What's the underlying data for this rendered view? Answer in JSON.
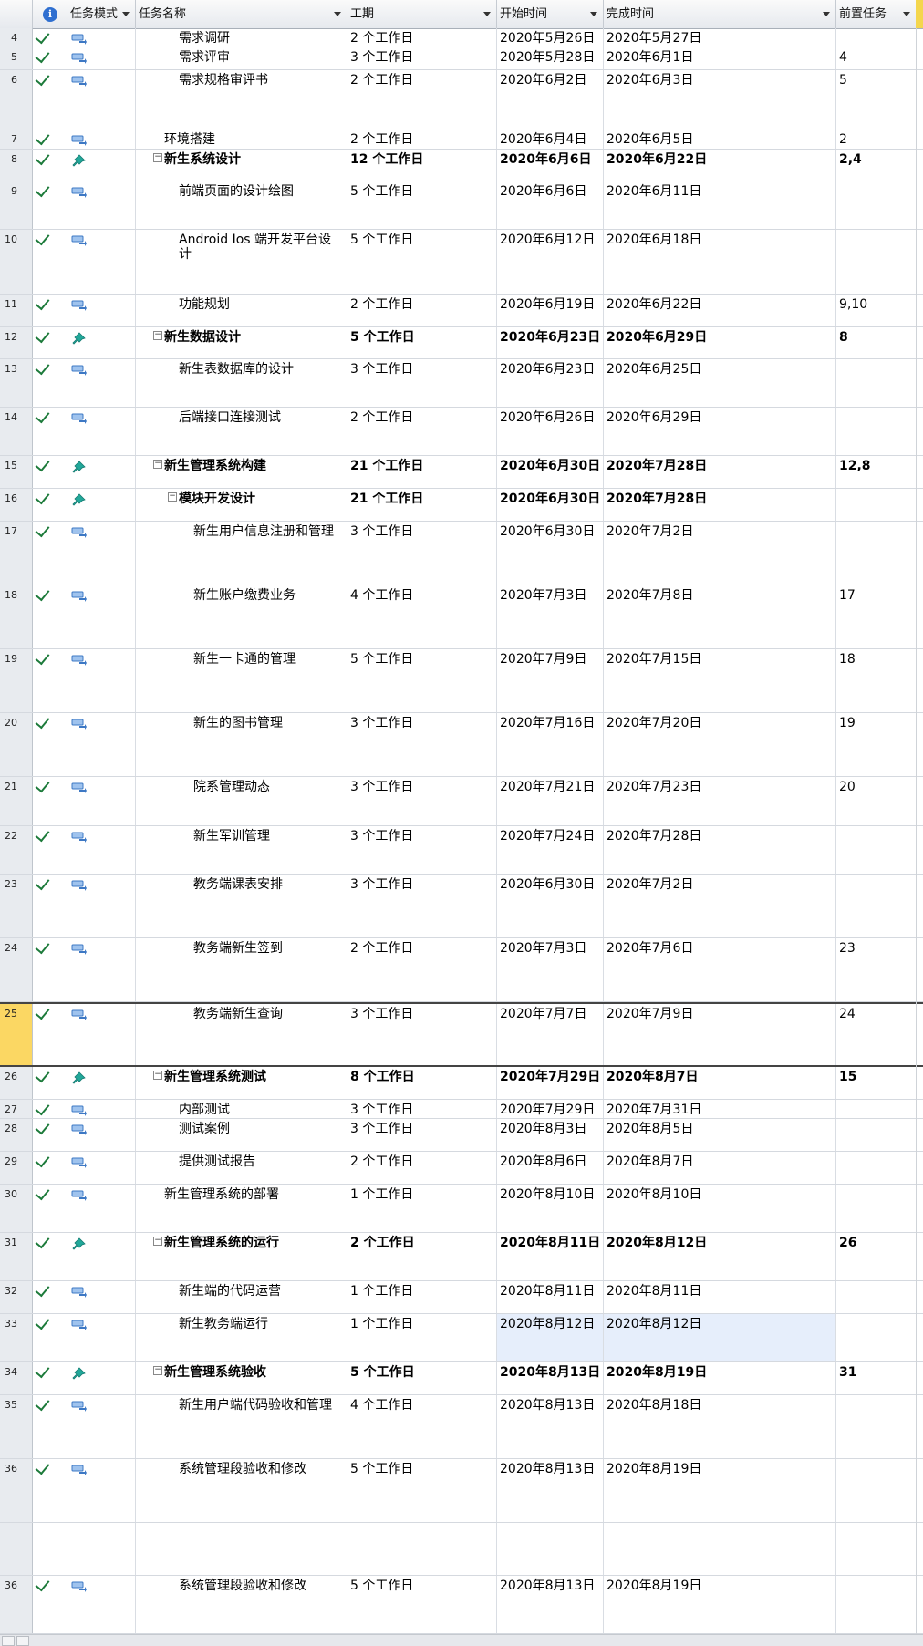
{
  "header": {
    "info_label": "i",
    "mode_label": "任务模式",
    "name_label": "任务名称",
    "duration_label": "工期",
    "start_label": "开始时间",
    "finish_label": "完成时间",
    "pred_label": "前置任务"
  },
  "colors": {
    "selected_row": "#fbd763",
    "check": "#1c7a3a",
    "manual_icon": "#3d78c4",
    "auto_pin": "#22a89a"
  },
  "rows": [
    {
      "id": "4",
      "name": "需求调研",
      "duration": "2 个工作日",
      "start": "2020年5月26日",
      "finish": "2020年5月27日",
      "pred": "",
      "mode": "manual-task-icon",
      "level": 2,
      "bold": false
    },
    {
      "id": "5",
      "name": "需求评审",
      "duration": "3 个工作日",
      "start": "2020年5月28日",
      "finish": "2020年6月1日",
      "pred": "4",
      "mode": "manual-task-icon",
      "level": 2,
      "bold": false
    },
    {
      "id": "6",
      "name": "需求规格审评书",
      "duration": "2 个工作日",
      "start": "2020年6月2日",
      "finish": "2020年6月3日",
      "pred": "5",
      "mode": "manual-task-icon",
      "level": 2,
      "bold": false
    },
    {
      "id": "7",
      "name": "环境搭建",
      "duration": "2 个工作日",
      "start": "2020年6月4日",
      "finish": "2020年6月5日",
      "pred": "2",
      "mode": "manual-task-icon",
      "level": 1,
      "bold": false
    },
    {
      "id": "8",
      "name": "新生系统设计",
      "duration": "12 个工作日",
      "start": "2020年6月6日",
      "finish": "2020年6月22日",
      "pred": "2,4",
      "mode": "auto-pin-icon",
      "level": 1,
      "bold": true
    },
    {
      "id": "9",
      "name": "前端页面的设计绘图",
      "duration": "5 个工作日",
      "start": "2020年6月6日",
      "finish": "2020年6月11日",
      "pred": "",
      "mode": "manual-task-icon",
      "level": 2,
      "bold": false
    },
    {
      "id": "10",
      "name": "Android Ios 端开发平台设计",
      "duration": "5 个工作日",
      "start": "2020年6月12日",
      "finish": "2020年6月18日",
      "pred": "",
      "mode": "manual-task-icon",
      "level": 2,
      "bold": false
    },
    {
      "id": "11",
      "name": "功能规划",
      "duration": "2 个工作日",
      "start": "2020年6月19日",
      "finish": "2020年6月22日",
      "pred": "9,10",
      "mode": "manual-task-icon",
      "level": 2,
      "bold": false
    },
    {
      "id": "12",
      "name": "新生数据设计",
      "duration": "5 个工作日",
      "start": "2020年6月23日",
      "finish": "2020年6月29日",
      "pred": "8",
      "mode": "auto-pin-icon",
      "level": 1,
      "bold": true
    },
    {
      "id": "13",
      "name": "新生表数据库的设计",
      "duration": "3 个工作日",
      "start": "2020年6月23日",
      "finish": "2020年6月25日",
      "pred": "",
      "mode": "manual-task-icon",
      "level": 2,
      "bold": false
    },
    {
      "id": "14",
      "name": "后端接口连接测试",
      "duration": "2 个工作日",
      "start": "2020年6月26日",
      "finish": "2020年6月29日",
      "pred": "",
      "mode": "manual-task-icon",
      "level": 2,
      "bold": false
    },
    {
      "id": "15",
      "name": "新生管理系统构建",
      "duration": "21 个工作日",
      "start": "2020年6月30日",
      "finish": "2020年7月28日",
      "pred": "12,8",
      "mode": "auto-pin-icon",
      "level": 1,
      "bold": true
    },
    {
      "id": "16",
      "name": "模块开发设计",
      "duration": "21 个工作日",
      "start": "2020年6月30日",
      "finish": "2020年7月28日",
      "pred": "",
      "mode": "auto-pin-icon",
      "level": 2,
      "bold": true
    },
    {
      "id": "17",
      "name": "新生用户信息注册和管理",
      "duration": "3 个工作日",
      "start": "2020年6月30日",
      "finish": "2020年7月2日",
      "pred": "",
      "mode": "manual-task-icon",
      "level": 3,
      "bold": false
    },
    {
      "id": "18",
      "name": "新生账户缴费业务",
      "duration": "4 个工作日",
      "start": "2020年7月3日",
      "finish": "2020年7月8日",
      "pred": "17",
      "mode": "manual-task-icon",
      "level": 3,
      "bold": false
    },
    {
      "id": "19",
      "name": "新生一卡通的管理",
      "duration": "5 个工作日",
      "start": "2020年7月9日",
      "finish": "2020年7月15日",
      "pred": "18",
      "mode": "manual-task-icon",
      "level": 3,
      "bold": false
    },
    {
      "id": "20",
      "name": "新生的图书管理",
      "duration": "3 个工作日",
      "start": "2020年7月16日",
      "finish": "2020年7月20日",
      "pred": "19",
      "mode": "manual-task-icon",
      "level": 3,
      "bold": false
    },
    {
      "id": "21",
      "name": "院系管理动态",
      "duration": "3 个工作日",
      "start": "2020年7月21日",
      "finish": "2020年7月23日",
      "pred": "20",
      "mode": "manual-task-icon",
      "level": 3,
      "bold": false
    },
    {
      "id": "22",
      "name": "新生军训管理",
      "duration": "3 个工作日",
      "start": "2020年7月24日",
      "finish": "2020年7月28日",
      "pred": "",
      "mode": "manual-task-icon",
      "level": 3,
      "bold": false
    },
    {
      "id": "23",
      "name": "教务端课表安排",
      "duration": "3 个工作日",
      "start": "2020年6月30日",
      "finish": "2020年7月2日",
      "pred": "",
      "mode": "manual-task-icon",
      "level": 3,
      "bold": false
    },
    {
      "id": "24",
      "name": "教务端新生签到",
      "duration": "2 个工作日",
      "start": "2020年7月3日",
      "finish": "2020年7月6日",
      "pred": "23",
      "mode": "manual-task-icon",
      "level": 3,
      "bold": false
    },
    {
      "id": "25",
      "name": "教务端新生查询",
      "duration": "3 个工作日",
      "start": "2020年7月7日",
      "finish": "2020年7月9日",
      "pred": "24",
      "mode": "manual-task-icon",
      "level": 3,
      "bold": false
    },
    {
      "id": "26",
      "name": "新生管理系统测试",
      "duration": "8 个工作日",
      "start": "2020年7月29日",
      "finish": "2020年8月7日",
      "pred": "15",
      "mode": "auto-pin-icon",
      "level": 1,
      "bold": true
    },
    {
      "id": "27",
      "name": "内部测试",
      "duration": "3 个工作日",
      "start": "2020年7月29日",
      "finish": "2020年7月31日",
      "pred": "",
      "mode": "manual-task-icon",
      "level": 2,
      "bold": false
    },
    {
      "id": "28",
      "name": "测试案例",
      "duration": "3 个工作日",
      "start": "2020年8月3日",
      "finish": "2020年8月5日",
      "pred": "",
      "mode": "manual-task-icon",
      "level": 2,
      "bold": false
    },
    {
      "id": "29",
      "name": "提供测试报告",
      "duration": "2 个工作日",
      "start": "2020年8月6日",
      "finish": "2020年8月7日",
      "pred": "",
      "mode": "manual-task-icon",
      "level": 2,
      "bold": false
    },
    {
      "id": "30",
      "name": "新生管理系统的部署",
      "duration": "1 个工作日",
      "start": "2020年8月10日",
      "finish": "2020年8月10日",
      "pred": "",
      "mode": "manual-task-icon",
      "level": 1,
      "bold": false
    },
    {
      "id": "31",
      "name": "新生管理系统的运行",
      "duration": "2 个工作日",
      "start": "2020年8月11日",
      "finish": "2020年8月12日",
      "pred": "26",
      "mode": "auto-pin-icon",
      "level": 1,
      "bold": true
    },
    {
      "id": "32",
      "name": "新生端的代码运营",
      "duration": "1 个工作日",
      "start": "2020年8月11日",
      "finish": "2020年8月11日",
      "pred": "",
      "mode": "manual-task-icon",
      "level": 2,
      "bold": false
    },
    {
      "id": "33",
      "name": "新生教务端运行",
      "duration": "1 个工作日",
      "start": "2020年8月12日",
      "finish": "2020年8月12日",
      "pred": "",
      "mode": "manual-task-icon",
      "level": 2,
      "bold": false
    },
    {
      "id": "34",
      "name": "新生管理系统验收",
      "duration": "5 个工作日",
      "start": "2020年8月13日",
      "finish": "2020年8月19日",
      "pred": "31",
      "mode": "auto-pin-icon",
      "level": 1,
      "bold": true
    },
    {
      "id": "35",
      "name": "新生用户端代码验收和管理",
      "duration": "4 个工作日",
      "start": "2020年8月13日",
      "finish": "2020年8月18日",
      "pred": "",
      "mode": "manual-task-icon",
      "level": 2,
      "bold": false
    },
    {
      "id": "36",
      "name": "系统管理段验收和修改",
      "duration": "5 个工作日",
      "start": "2020年8月13日",
      "finish": "2020年8月19日",
      "pred": "",
      "mode": "manual-task-icon",
      "level": 2,
      "bold": false
    },
    {
      "id": "",
      "name": "",
      "duration": "",
      "start": "",
      "finish": "",
      "pred": "",
      "mode": "",
      "level": 2,
      "bold": false
    },
    {
      "id": "36",
      "name": "系统管理段验收和修改",
      "duration": "5 个工作日",
      "start": "2020年8月13日",
      "finish": "2020年8月19日",
      "pred": "",
      "mode": "manual-task-icon",
      "level": 2,
      "bold": false
    }
  ]
}
